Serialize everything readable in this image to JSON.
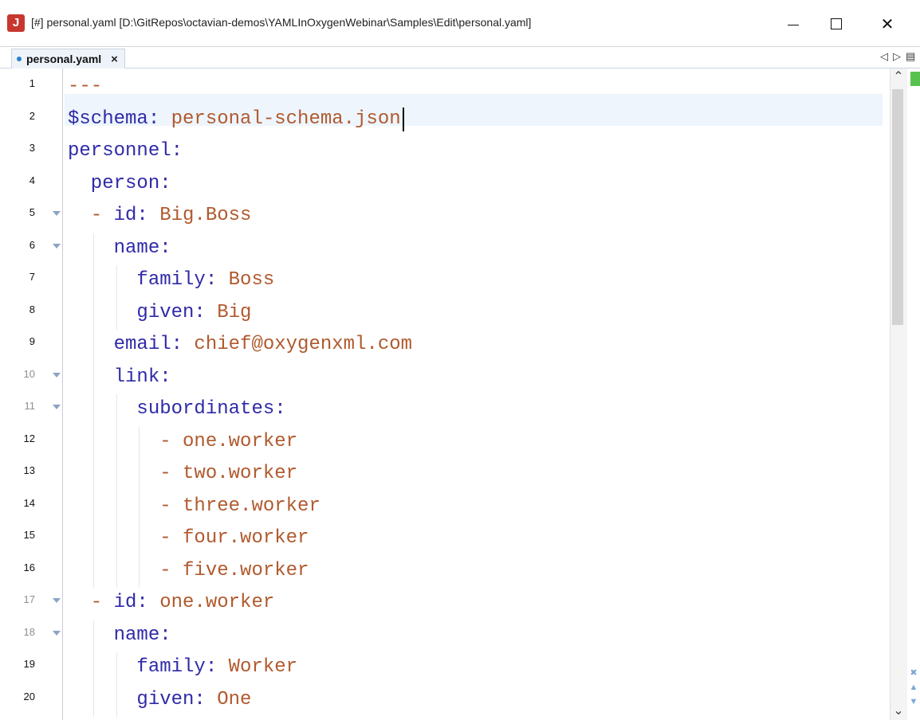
{
  "window": {
    "title": "[#] personal.yaml [D:\\GitRepos\\octavian-demos\\YAMLInOxygenWebinar\\Samples\\Edit\\personal.yaml]",
    "app_icon": "J",
    "controls": {
      "minimize": "minimize-icon",
      "maximize": "maximize-icon",
      "close": "close-icon"
    }
  },
  "tab": {
    "label": "personal.yaml",
    "modified_dot_color": "#2b7fc9",
    "close_glyph": "×"
  },
  "tab_nav": {
    "prev": "◁",
    "next": "▷",
    "menu": "▤"
  },
  "editor": {
    "lines": [
      {
        "n": "1",
        "fold": false,
        "parts": [
          {
            "t": "---",
            "c": "val"
          }
        ]
      },
      {
        "n": "2",
        "fold": false,
        "parts": [
          {
            "t": "$schema:",
            "c": "key"
          },
          {
            "t": " personal-schema.json",
            "c": "val"
          }
        ]
      },
      {
        "n": "3",
        "fold": false,
        "parts": [
          {
            "t": "personnel:",
            "c": "key"
          }
        ]
      },
      {
        "n": "4",
        "fold": false,
        "parts": [
          {
            "t": "  person:",
            "c": "key"
          }
        ]
      },
      {
        "n": "5",
        "fold": true,
        "parts": [
          {
            "t": "  - ",
            "c": "val"
          },
          {
            "t": "id:",
            "c": "key"
          },
          {
            "t": " Big.Boss",
            "c": "val"
          }
        ]
      },
      {
        "n": "6",
        "fold": true,
        "parts": [
          {
            "t": "    name:",
            "c": "key"
          }
        ]
      },
      {
        "n": "7",
        "fold": false,
        "parts": [
          {
            "t": "      family:",
            "c": "key"
          },
          {
            "t": " Boss",
            "c": "val"
          }
        ]
      },
      {
        "n": "8",
        "fold": false,
        "parts": [
          {
            "t": "      given:",
            "c": "key"
          },
          {
            "t": " Big",
            "c": "val"
          }
        ]
      },
      {
        "n": "9",
        "fold": false,
        "parts": [
          {
            "t": "    email:",
            "c": "key"
          },
          {
            "t": " chief@oxygenxml.com",
            "c": "val"
          }
        ]
      },
      {
        "n": "10",
        "fold": true,
        "parts": [
          {
            "t": "    link:",
            "c": "key"
          }
        ]
      },
      {
        "n": "11",
        "fold": true,
        "parts": [
          {
            "t": "      subordinates:",
            "c": "key"
          }
        ]
      },
      {
        "n": "12",
        "fold": false,
        "parts": [
          {
            "t": "        - one.worker",
            "c": "val"
          }
        ]
      },
      {
        "n": "13",
        "fold": false,
        "parts": [
          {
            "t": "        - two.worker",
            "c": "val"
          }
        ]
      },
      {
        "n": "14",
        "fold": false,
        "parts": [
          {
            "t": "        - three.worker",
            "c": "val"
          }
        ]
      },
      {
        "n": "15",
        "fold": false,
        "parts": [
          {
            "t": "        - four.worker",
            "c": "val"
          }
        ]
      },
      {
        "n": "16",
        "fold": false,
        "parts": [
          {
            "t": "        - five.worker",
            "c": "val"
          }
        ]
      },
      {
        "n": "17",
        "fold": true,
        "parts": [
          {
            "t": "  - ",
            "c": "val"
          },
          {
            "t": "id:",
            "c": "key"
          },
          {
            "t": " one.worker",
            "c": "val"
          }
        ]
      },
      {
        "n": "18",
        "fold": true,
        "parts": [
          {
            "t": "    name:",
            "c": "key"
          }
        ]
      },
      {
        "n": "19",
        "fold": false,
        "parts": [
          {
            "t": "      family:",
            "c": "key"
          },
          {
            "t": " Worker",
            "c": "val"
          }
        ]
      },
      {
        "n": "20",
        "fold": false,
        "parts": [
          {
            "t": "      given:",
            "c": "key"
          },
          {
            "t": " One",
            "c": "val"
          }
        ]
      }
    ],
    "colors": {
      "key": "#2f2aa8",
      "value": "#b05a2e",
      "current_line": "#eef5fd"
    }
  },
  "scrollbar": {
    "up": "⌃",
    "down": "⌄",
    "thumb_fraction": 0.36
  },
  "status": {
    "ok_color": "#58c24e",
    "icons": [
      "clear-icon",
      "up-arrow-icon",
      "down-arrow-icon"
    ]
  }
}
